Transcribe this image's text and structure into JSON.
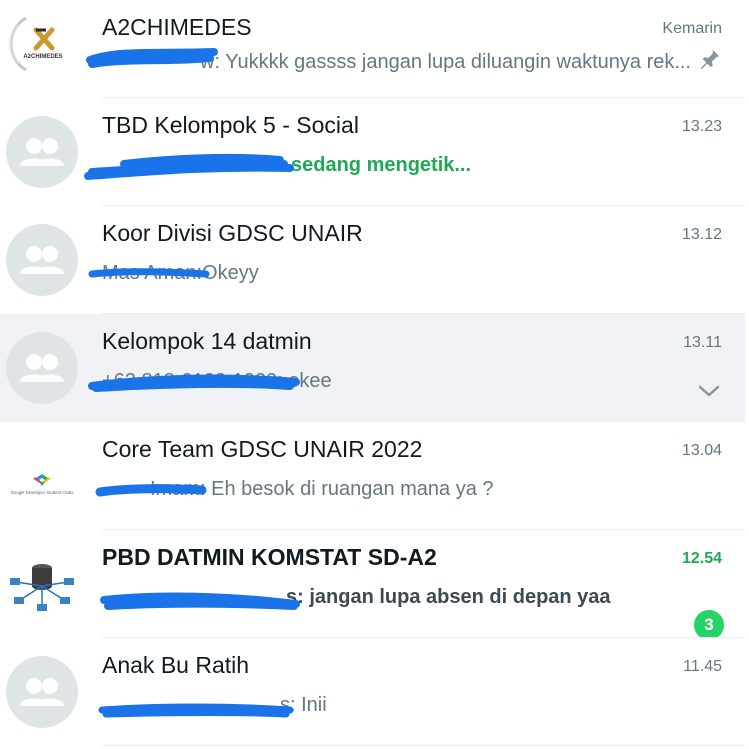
{
  "chats": [
    {
      "name": "A2CHIMEDES",
      "time": "Kemarin",
      "preview_sender_fragment": "w:",
      "preview_text": "Yukkkk gassss jangan lupa diluangin waktunya rek...",
      "pinned": true,
      "avatar_logo_text": "A2CHIMEDES"
    },
    {
      "name": "TBD Kelompok 5 - Social",
      "time": "13.23",
      "preview_text": "sedang mengetik...",
      "typing": true
    },
    {
      "name": "Koor Divisi GDSC UNAIR",
      "time": "13.12",
      "preview_sender_fragment": "Mas Aman:",
      "preview_text": "Okeyy"
    },
    {
      "name": "Kelompok 14 datmin",
      "time": "13.11",
      "preview_sender_fragment": "+62 818-0128-1920:",
      "preview_text": "okee",
      "selected": true
    },
    {
      "name": "Core Team GDSC UNAIR 2022",
      "time": "13.04",
      "preview_sender_fragment": "Imam:",
      "preview_text": "Eh besok di ruangan mana ya ?",
      "avatar_logo_text": "Google Developer Student Clubs"
    },
    {
      "name": "PBD DATMIN KOMSTAT SD-A2",
      "time": "12.54",
      "preview_sender_fragment": "s:",
      "preview_text": "jangan lupa absen di depan yaa",
      "unread_count": "3",
      "unread": true
    },
    {
      "name": "Anak Bu Ratih",
      "time": "11.45",
      "preview_sender_fragment": "s:",
      "preview_text": "Inii"
    }
  ],
  "colors": {
    "accent_green": "#1fa855",
    "badge_green": "#25d366",
    "scribble_blue": "#1a73e8",
    "selected_row": "#f0f2f5"
  }
}
